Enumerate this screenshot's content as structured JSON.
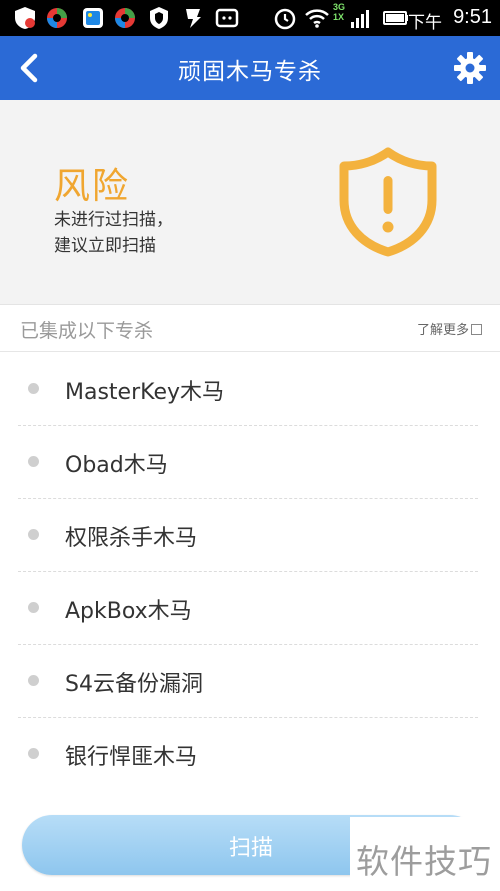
{
  "status_bar": {
    "network_top": "3G",
    "network_bottom": "1X",
    "ampm": "下午",
    "time": "9:51"
  },
  "header": {
    "title": "顽固木马专杀"
  },
  "risk": {
    "title": "风险",
    "description": "未进行过扫描，\n建议立即扫描",
    "accent_color": "#f0a630"
  },
  "section": {
    "title": "已集成以下专杀",
    "learn_more": "了解更多"
  },
  "items": [
    {
      "label": "MasterKey木马"
    },
    {
      "label": "Obad木马"
    },
    {
      "label": "权限杀手木马"
    },
    {
      "label": "ApkBox木马"
    },
    {
      "label": "S4云备份漏洞"
    },
    {
      "label": "银行悍匪木马"
    }
  ],
  "scan_button": {
    "label": "扫描"
  },
  "watermark": {
    "text": "软件技巧"
  },
  "colors": {
    "header_bg": "#2b6ad6",
    "scan_button": "#8ec6ee"
  }
}
